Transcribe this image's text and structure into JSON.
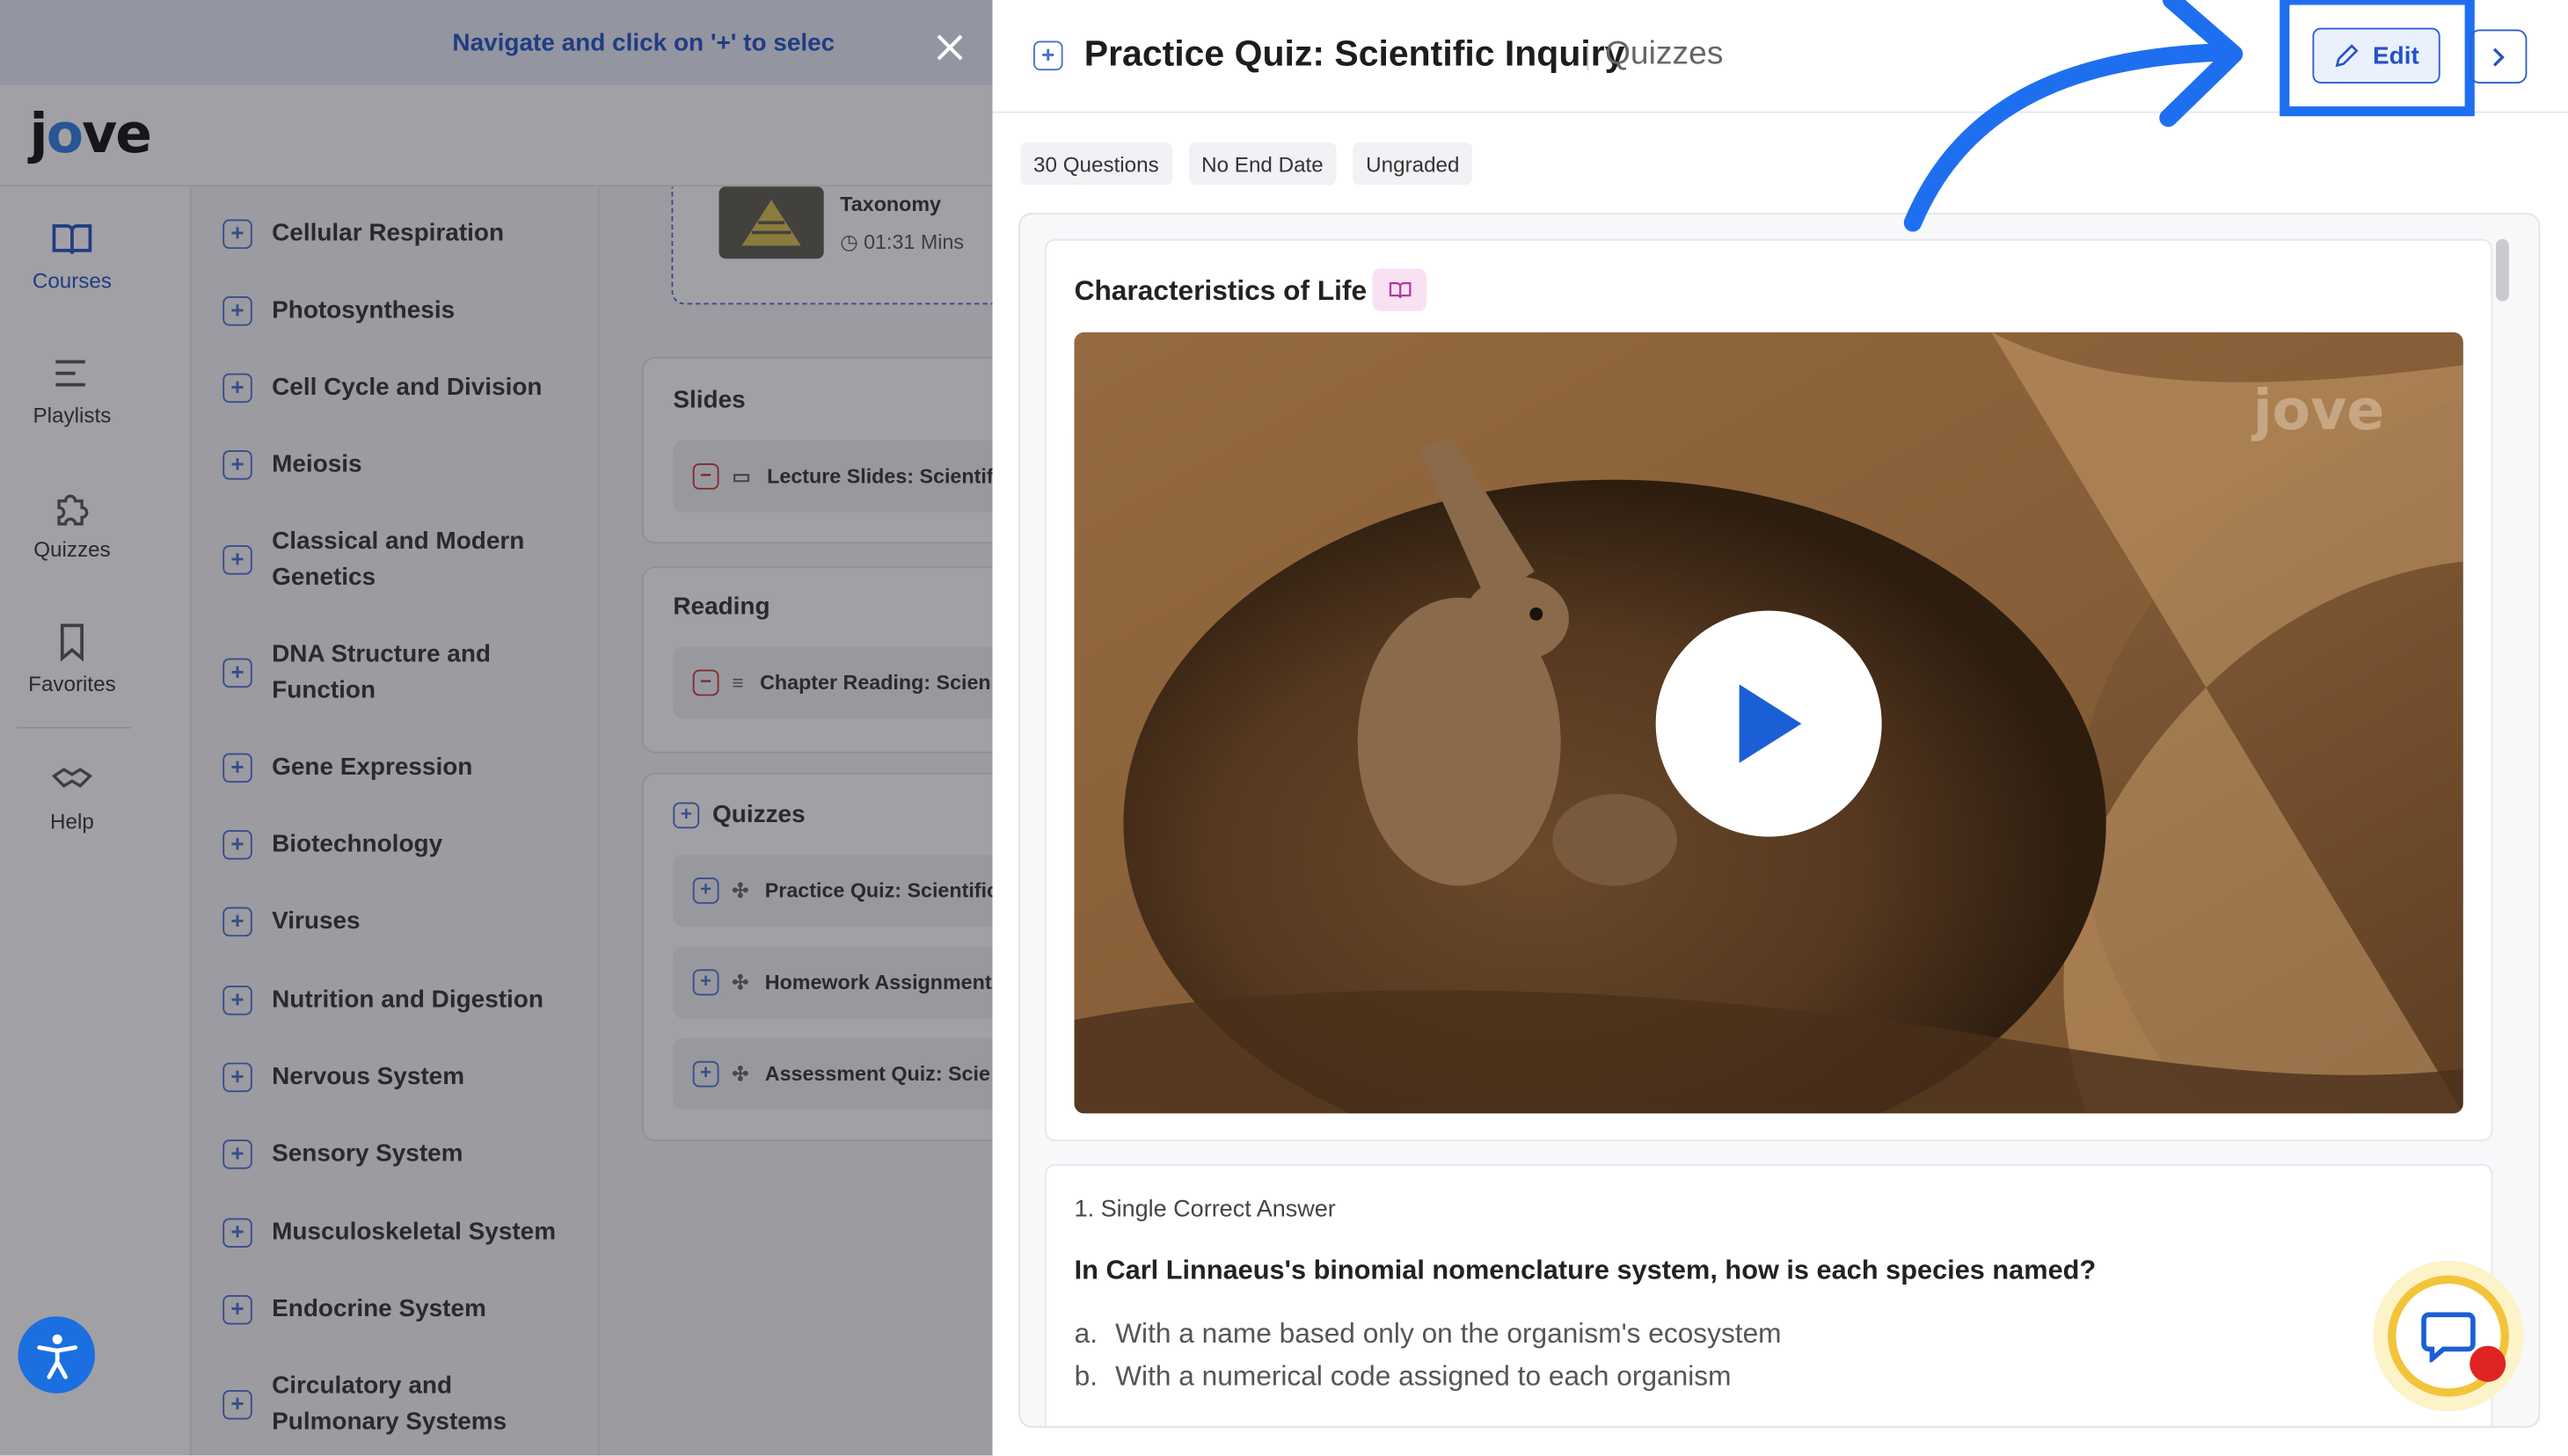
{
  "banner": {
    "text": "Navigate and click on '+' to selec"
  },
  "logo": {
    "text_before": "j",
    "text_accent": "o",
    "text_after": "ve"
  },
  "rail": {
    "items": [
      {
        "label": "Courses",
        "icon": "book-icon"
      },
      {
        "label": "Playlists",
        "icon": "list-icon"
      },
      {
        "label": "Quizzes",
        "icon": "puzzle-icon"
      },
      {
        "label": "Favorites",
        "icon": "bookmark-icon"
      },
      {
        "label": "Help",
        "icon": "handshake-icon"
      }
    ],
    "active": "Courses"
  },
  "chapters": [
    "Cellular Respiration",
    "Photosynthesis",
    "Cell Cycle and Division",
    "Meiosis",
    "Classical and Modern Genetics",
    "DNA Structure and Function",
    "Gene Expression",
    "Biotechnology",
    "Viruses",
    "Nutrition and Digestion",
    "Nervous System",
    "Sensory System",
    "Musculoskeletal System",
    "Endocrine System",
    "Circulatory and Pulmonary Systems"
  ],
  "content": {
    "video_item": {
      "title": "Taxonomy",
      "duration": "01:31 Mins"
    },
    "slides": {
      "heading": "Slides",
      "items": [
        "Lecture Slides: Scientif"
      ]
    },
    "reading": {
      "heading": "Reading",
      "items": [
        "Chapter Reading: Scien"
      ]
    },
    "quizzes": {
      "heading": "Quizzes",
      "items": [
        "Practice Quiz: Scientific",
        "Homework Assignment",
        "Assessment Quiz: Scie"
      ]
    }
  },
  "drawer": {
    "title": "Practice Quiz: Scientific Inquiry",
    "subtitle": "Quizzes",
    "edit_label": "Edit",
    "chips": [
      "30 Questions",
      "No End Date",
      "Ungraded"
    ],
    "video_card": {
      "title": "Characteristics of Life",
      "watermark": "jove"
    },
    "question": {
      "type": "1. Single Correct Answer",
      "text": "In Carl Linnaeus's binomial nomenclature system, how is each species named?",
      "options": [
        {
          "letter": "a.",
          "text": "With a name based only on the organism's ecosystem"
        },
        {
          "letter": "b.",
          "text": "With a numerical code assigned to each organism"
        }
      ]
    }
  },
  "colors": {
    "accent": "#2452c6",
    "highlight": "#1e6ff0",
    "overlay": "rgba(30,32,40,0.42)"
  }
}
